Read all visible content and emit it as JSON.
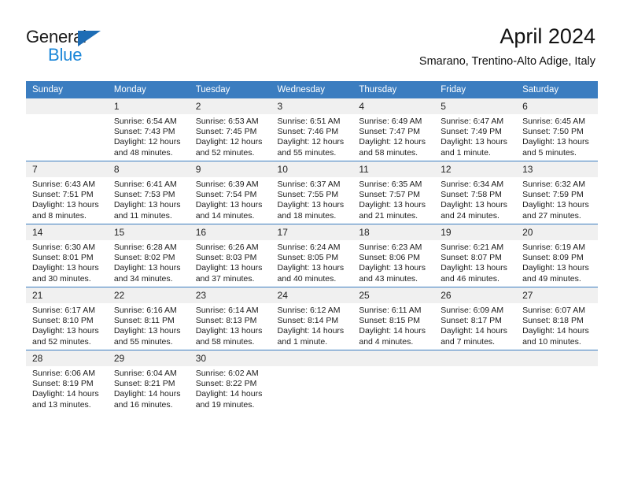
{
  "brand": {
    "name_part1": "General",
    "name_part2": "Blue",
    "triangle_color": "#1e6db5",
    "blue_color": "#1a86d8"
  },
  "header": {
    "title": "April 2024",
    "subtitle": "Smarano, Trentino-Alto Adige, Italy"
  },
  "theme": {
    "header_bg": "#3b7dc0",
    "header_text": "#ffffff",
    "daynum_bg": "#f0f0f0",
    "grid_line": "#3b7dc0",
    "body_text": "#1c1c1c"
  },
  "weekdays": [
    "Sunday",
    "Monday",
    "Tuesday",
    "Wednesday",
    "Thursday",
    "Friday",
    "Saturday"
  ],
  "weeks": [
    [
      {
        "day": "",
        "sunrise": "",
        "sunset": "",
        "daylight1": "",
        "daylight2": ""
      },
      {
        "day": "1",
        "sunrise": "Sunrise: 6:54 AM",
        "sunset": "Sunset: 7:43 PM",
        "daylight1": "Daylight: 12 hours",
        "daylight2": "and 48 minutes."
      },
      {
        "day": "2",
        "sunrise": "Sunrise: 6:53 AM",
        "sunset": "Sunset: 7:45 PM",
        "daylight1": "Daylight: 12 hours",
        "daylight2": "and 52 minutes."
      },
      {
        "day": "3",
        "sunrise": "Sunrise: 6:51 AM",
        "sunset": "Sunset: 7:46 PM",
        "daylight1": "Daylight: 12 hours",
        "daylight2": "and 55 minutes."
      },
      {
        "day": "4",
        "sunrise": "Sunrise: 6:49 AM",
        "sunset": "Sunset: 7:47 PM",
        "daylight1": "Daylight: 12 hours",
        "daylight2": "and 58 minutes."
      },
      {
        "day": "5",
        "sunrise": "Sunrise: 6:47 AM",
        "sunset": "Sunset: 7:49 PM",
        "daylight1": "Daylight: 13 hours",
        "daylight2": "and 1 minute."
      },
      {
        "day": "6",
        "sunrise": "Sunrise: 6:45 AM",
        "sunset": "Sunset: 7:50 PM",
        "daylight1": "Daylight: 13 hours",
        "daylight2": "and 5 minutes."
      }
    ],
    [
      {
        "day": "7",
        "sunrise": "Sunrise: 6:43 AM",
        "sunset": "Sunset: 7:51 PM",
        "daylight1": "Daylight: 13 hours",
        "daylight2": "and 8 minutes."
      },
      {
        "day": "8",
        "sunrise": "Sunrise: 6:41 AM",
        "sunset": "Sunset: 7:53 PM",
        "daylight1": "Daylight: 13 hours",
        "daylight2": "and 11 minutes."
      },
      {
        "day": "9",
        "sunrise": "Sunrise: 6:39 AM",
        "sunset": "Sunset: 7:54 PM",
        "daylight1": "Daylight: 13 hours",
        "daylight2": "and 14 minutes."
      },
      {
        "day": "10",
        "sunrise": "Sunrise: 6:37 AM",
        "sunset": "Sunset: 7:55 PM",
        "daylight1": "Daylight: 13 hours",
        "daylight2": "and 18 minutes."
      },
      {
        "day": "11",
        "sunrise": "Sunrise: 6:35 AM",
        "sunset": "Sunset: 7:57 PM",
        "daylight1": "Daylight: 13 hours",
        "daylight2": "and 21 minutes."
      },
      {
        "day": "12",
        "sunrise": "Sunrise: 6:34 AM",
        "sunset": "Sunset: 7:58 PM",
        "daylight1": "Daylight: 13 hours",
        "daylight2": "and 24 minutes."
      },
      {
        "day": "13",
        "sunrise": "Sunrise: 6:32 AM",
        "sunset": "Sunset: 7:59 PM",
        "daylight1": "Daylight: 13 hours",
        "daylight2": "and 27 minutes."
      }
    ],
    [
      {
        "day": "14",
        "sunrise": "Sunrise: 6:30 AM",
        "sunset": "Sunset: 8:01 PM",
        "daylight1": "Daylight: 13 hours",
        "daylight2": "and 30 minutes."
      },
      {
        "day": "15",
        "sunrise": "Sunrise: 6:28 AM",
        "sunset": "Sunset: 8:02 PM",
        "daylight1": "Daylight: 13 hours",
        "daylight2": "and 34 minutes."
      },
      {
        "day": "16",
        "sunrise": "Sunrise: 6:26 AM",
        "sunset": "Sunset: 8:03 PM",
        "daylight1": "Daylight: 13 hours",
        "daylight2": "and 37 minutes."
      },
      {
        "day": "17",
        "sunrise": "Sunrise: 6:24 AM",
        "sunset": "Sunset: 8:05 PM",
        "daylight1": "Daylight: 13 hours",
        "daylight2": "and 40 minutes."
      },
      {
        "day": "18",
        "sunrise": "Sunrise: 6:23 AM",
        "sunset": "Sunset: 8:06 PM",
        "daylight1": "Daylight: 13 hours",
        "daylight2": "and 43 minutes."
      },
      {
        "day": "19",
        "sunrise": "Sunrise: 6:21 AM",
        "sunset": "Sunset: 8:07 PM",
        "daylight1": "Daylight: 13 hours",
        "daylight2": "and 46 minutes."
      },
      {
        "day": "20",
        "sunrise": "Sunrise: 6:19 AM",
        "sunset": "Sunset: 8:09 PM",
        "daylight1": "Daylight: 13 hours",
        "daylight2": "and 49 minutes."
      }
    ],
    [
      {
        "day": "21",
        "sunrise": "Sunrise: 6:17 AM",
        "sunset": "Sunset: 8:10 PM",
        "daylight1": "Daylight: 13 hours",
        "daylight2": "and 52 minutes."
      },
      {
        "day": "22",
        "sunrise": "Sunrise: 6:16 AM",
        "sunset": "Sunset: 8:11 PM",
        "daylight1": "Daylight: 13 hours",
        "daylight2": "and 55 minutes."
      },
      {
        "day": "23",
        "sunrise": "Sunrise: 6:14 AM",
        "sunset": "Sunset: 8:13 PM",
        "daylight1": "Daylight: 13 hours",
        "daylight2": "and 58 minutes."
      },
      {
        "day": "24",
        "sunrise": "Sunrise: 6:12 AM",
        "sunset": "Sunset: 8:14 PM",
        "daylight1": "Daylight: 14 hours",
        "daylight2": "and 1 minute."
      },
      {
        "day": "25",
        "sunrise": "Sunrise: 6:11 AM",
        "sunset": "Sunset: 8:15 PM",
        "daylight1": "Daylight: 14 hours",
        "daylight2": "and 4 minutes."
      },
      {
        "day": "26",
        "sunrise": "Sunrise: 6:09 AM",
        "sunset": "Sunset: 8:17 PM",
        "daylight1": "Daylight: 14 hours",
        "daylight2": "and 7 minutes."
      },
      {
        "day": "27",
        "sunrise": "Sunrise: 6:07 AM",
        "sunset": "Sunset: 8:18 PM",
        "daylight1": "Daylight: 14 hours",
        "daylight2": "and 10 minutes."
      }
    ],
    [
      {
        "day": "28",
        "sunrise": "Sunrise: 6:06 AM",
        "sunset": "Sunset: 8:19 PM",
        "daylight1": "Daylight: 14 hours",
        "daylight2": "and 13 minutes."
      },
      {
        "day": "29",
        "sunrise": "Sunrise: 6:04 AM",
        "sunset": "Sunset: 8:21 PM",
        "daylight1": "Daylight: 14 hours",
        "daylight2": "and 16 minutes."
      },
      {
        "day": "30",
        "sunrise": "Sunrise: 6:02 AM",
        "sunset": "Sunset: 8:22 PM",
        "daylight1": "Daylight: 14 hours",
        "daylight2": "and 19 minutes."
      },
      {
        "day": "",
        "sunrise": "",
        "sunset": "",
        "daylight1": "",
        "daylight2": ""
      },
      {
        "day": "",
        "sunrise": "",
        "sunset": "",
        "daylight1": "",
        "daylight2": ""
      },
      {
        "day": "",
        "sunrise": "",
        "sunset": "",
        "daylight1": "",
        "daylight2": ""
      },
      {
        "day": "",
        "sunrise": "",
        "sunset": "",
        "daylight1": "",
        "daylight2": ""
      }
    ]
  ]
}
